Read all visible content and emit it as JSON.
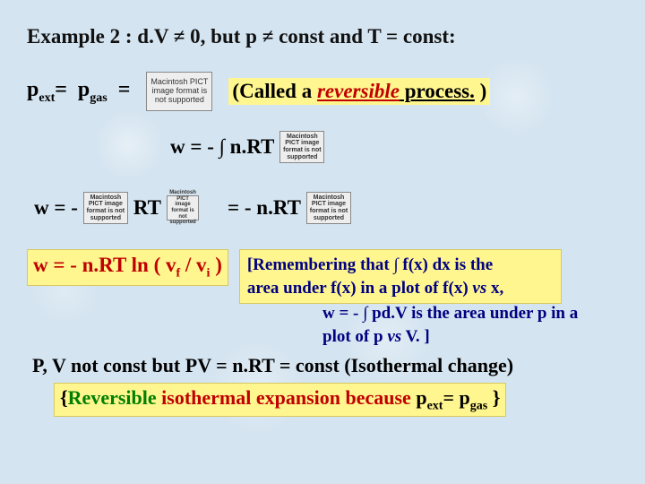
{
  "heading": "Example 2 : d.V  ≠  0, but p  ≠  const and T  =  const:",
  "pict": "Macintosh PICT image format is not supported",
  "pict_s": "Macintosh PICT image format is not supported",
  "row1": {
    "pext_html": "p<sub class='sub'>ext</sub>=  p<sub class='sub'>gas</sub>  =",
    "called_pre": "(Called a ",
    "called_rev": "reversible",
    "called_proc": " process.",
    "called_close": " )"
  },
  "row2": {
    "w": "w  =  - ∫ n.RT"
  },
  "row3": {
    "w": "w  =  -",
    "rt": "RT",
    "eq": "=  - n.RT"
  },
  "formula": "w  =  - n.RT  ln ( v",
  "formula_f": "f",
  "formula_mid": " / v",
  "formula_i": "i",
  "formula_end": " )",
  "remember": {
    "l1": "[Remembering that ∫ f(x) dx is the",
    "l2": " area under f(x) in a plot of f(x) ",
    "l2b": "vs",
    "l2c": " x,",
    "l3": "w = - ∫ pd.V is the area under p in a",
    "l4": "plot of p ",
    "l4b": "vs",
    "l4c": " V. ]"
  },
  "pvline": "P, V not const but PV = n.RT = const (Isothermal change)",
  "final": {
    "open": "{",
    "rev": "Reversible",
    "iso": " isothermal expansion because ",
    "pext": "p",
    "pext_s": "ext",
    "eq": "=  p",
    "pgas_s": "gas",
    "sp": " ",
    "close": "}"
  }
}
